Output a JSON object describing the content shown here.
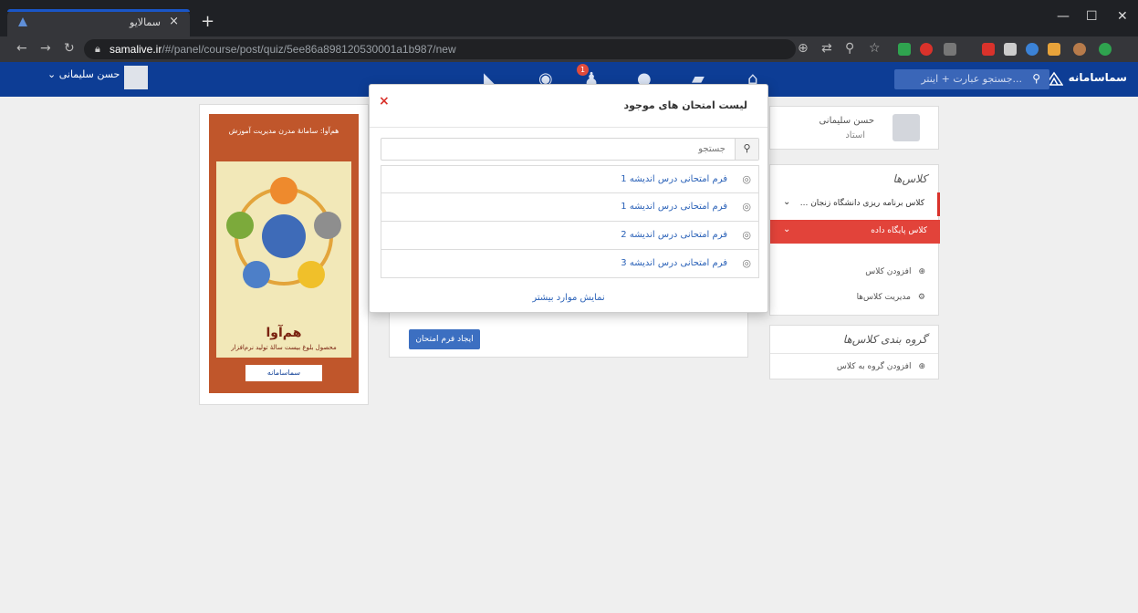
{
  "browser": {
    "tab_title": "سمالایو",
    "tab_close": "×",
    "new_tab": "+",
    "url_host": "samalive.ir",
    "url_path": "/#/panel/course/post/quiz/5ee86a898120530001a1b987/new",
    "window_controls": [
      "—",
      "☐",
      "✕"
    ]
  },
  "header": {
    "logo_text": "سماسامانه",
    "search_placeholder": "جستجو عبارت + اینتر...",
    "notification_count": "1",
    "user_name": "حسن سلیمانی",
    "icons": [
      "home-icon",
      "book-icon",
      "chat-icon",
      "bell-icon",
      "globe-icon",
      "rss-icon"
    ]
  },
  "profile": {
    "name": "حسن سلیمانی",
    "role": "استاد"
  },
  "classes": {
    "title": "کلاس‌ها",
    "items": [
      {
        "label": "کلاس برنامه ریزی دانشگاه زنجان ..."
      },
      {
        "label": "کلاس پایگاه داده"
      }
    ],
    "actions": [
      {
        "label": "افزودن کلاس",
        "icon": "plus-circle-icon"
      },
      {
        "label": "مدیریت کلاس‌ها",
        "icon": "gear-icon"
      }
    ]
  },
  "groups": {
    "title": "گروه بندی کلاس‌ها",
    "action": "افزودن گروه به کلاس"
  },
  "middle": {
    "create_button": "ایجاد فرم امتحان"
  },
  "poster": {
    "head": "هم‌آوا: سامانهٔ مدرن مدیریت آموزش",
    "title": "هم‌آوا",
    "subtitle": "محصول بلوغ بیست سالهٔ تولید نرم‌افزار",
    "brand": "سماسامانه"
  },
  "modal": {
    "title": "لیست امتحان های موجود",
    "close": "×",
    "search_placeholder": "جستجو",
    "exams": [
      {
        "name": "فرم امتحانی درس اندیشه 1"
      },
      {
        "name": "فرم امتحانی درس اندیشه 1"
      },
      {
        "name": "فرم امتحانی درس اندیشه 2"
      },
      {
        "name": "فرم امتحانی درس اندیشه 3"
      }
    ],
    "show_more": "نمایش موارد بیشتر"
  },
  "colors": {
    "header_blue": "#0d3d95",
    "accent_red": "#e2433a",
    "link_blue": "#2b62b8",
    "button_blue": "#3c6fc1"
  }
}
